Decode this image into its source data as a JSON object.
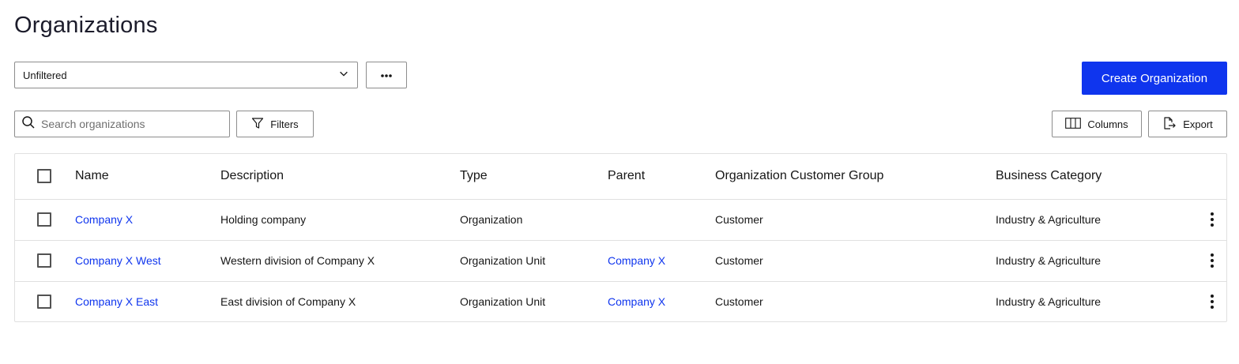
{
  "header": {
    "title": "Organizations"
  },
  "toolbar": {
    "filter_select_value": "Unfiltered",
    "create_label": "Create Organization",
    "search_placeholder": "Search organizations",
    "filters_label": "Filters",
    "columns_label": "Columns",
    "export_label": "Export"
  },
  "table": {
    "columns": [
      "Name",
      "Description",
      "Type",
      "Parent",
      "Organization Customer Group",
      "Business Category"
    ],
    "rows": [
      {
        "name": "Company X",
        "description": "Holding company",
        "type": "Organization",
        "parent": "",
        "group": "Customer",
        "category": "Industry & Agriculture"
      },
      {
        "name": "Company X West",
        "description": "Western division of Company X",
        "type": "Organization Unit",
        "parent": "Company X",
        "group": "Customer",
        "category": "Industry & Agriculture"
      },
      {
        "name": "Company X East",
        "description": "East division of Company X",
        "type": "Organization Unit",
        "parent": "Company X",
        "group": "Customer",
        "category": "Industry & Agriculture"
      }
    ]
  },
  "colors": {
    "accent": "#0f35ee",
    "border": "#8d8d8d",
    "row_divider": "#e0e0e0"
  }
}
